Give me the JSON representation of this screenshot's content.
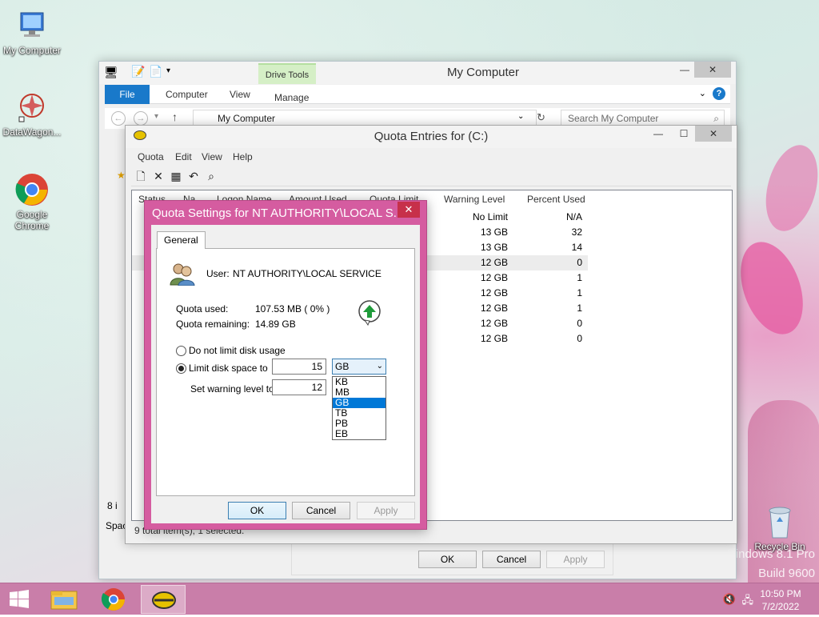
{
  "desktop": {
    "icons": [
      {
        "label": "My Computer"
      },
      {
        "label": "DataWagon..."
      },
      {
        "label": "Google Chrome"
      },
      {
        "label": "Recycle Bin"
      }
    ],
    "watermark_line1": "Windows 8.1 Pro",
    "watermark_line2": "Build 9600"
  },
  "explorer": {
    "title": "My Computer",
    "tabs": [
      "File",
      "Computer",
      "View",
      "Manage"
    ],
    "contextual_tab": "Drive Tools",
    "address": "My Computer",
    "search_placeholder": "Search My Computer",
    "footer_left_1": "8 i",
    "footer_left_2": "Spac",
    "buttons": {
      "ok": "OK",
      "cancel": "Cancel",
      "apply": "Apply"
    }
  },
  "quota_window": {
    "title": "Quota Entries for  (C:)",
    "menu": [
      "Quota",
      "Edit",
      "View",
      "Help"
    ],
    "columns": [
      "Status",
      "Na",
      "Logon Name",
      "Amount Used",
      "Quota Limit",
      "Warning Level",
      "Percent Used"
    ],
    "rows": [
      {
        "warning": "No Limit",
        "percent": "N/A"
      },
      {
        "warning": "13 GB",
        "percent": "32"
      },
      {
        "warning": "13 GB",
        "percent": "14"
      },
      {
        "warning": "12 GB",
        "percent": "0"
      },
      {
        "warning": "12 GB",
        "percent": "1"
      },
      {
        "warning": "12 GB",
        "percent": "1"
      },
      {
        "warning": "12 GB",
        "percent": "1"
      },
      {
        "warning": "12 GB",
        "percent": "0"
      },
      {
        "warning": "12 GB",
        "percent": "0"
      }
    ],
    "status": "9 total item(s), 1 selected."
  },
  "dialog": {
    "title": "Quota Settings for NT AUTHORITY\\LOCAL S...",
    "tab": "General",
    "user_label": "User:",
    "user_value": "NT AUTHORITY\\LOCAL SERVICE",
    "quota_used_label": "Quota used:",
    "quota_used_value": "107.53 MB ( 0% )",
    "quota_remaining_label": "Quota remaining:",
    "quota_remaining_value": "14.89 GB",
    "radio_no_limit": "Do not limit disk usage",
    "radio_limit": "Limit disk space to",
    "limit_value": "15",
    "limit_unit": "GB",
    "warning_label": "Set warning level to",
    "warning_value": "12",
    "unit_options": [
      "KB",
      "MB",
      "GB",
      "TB",
      "PB",
      "EB"
    ],
    "selected_unit_index": 2,
    "buttons": {
      "ok": "OK",
      "cancel": "Cancel",
      "apply": "Apply"
    }
  },
  "taskbar": {
    "time": "10:50 PM",
    "date": "7/2/2022"
  }
}
